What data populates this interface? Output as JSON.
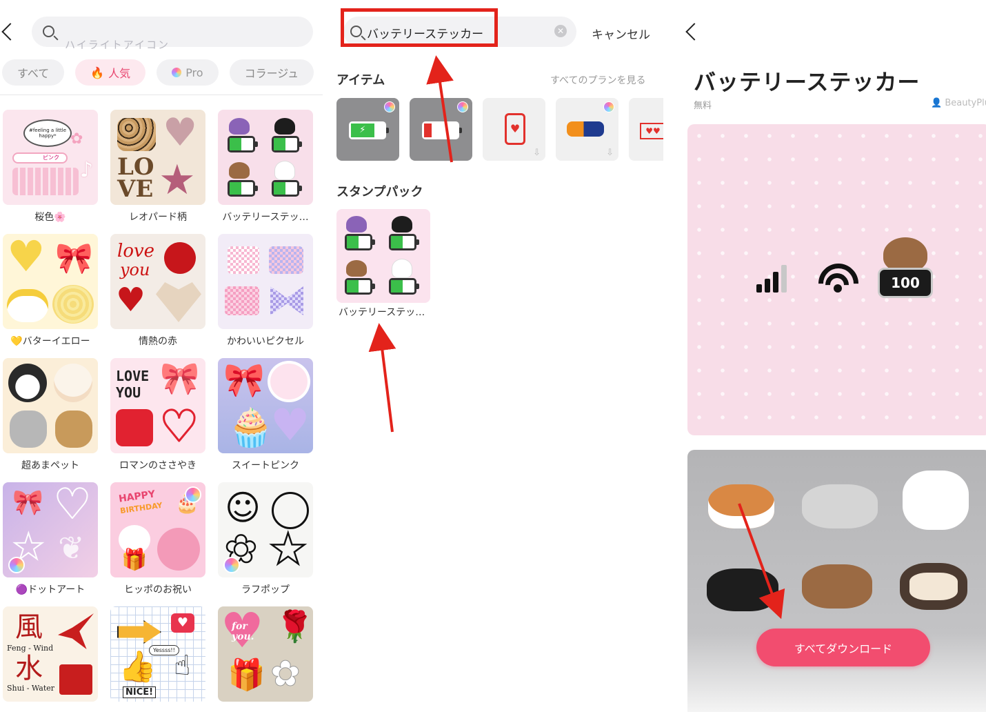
{
  "panel_list": {
    "search_placeholder": "ハイライトアイコン",
    "chips": [
      {
        "label": "すべて"
      },
      {
        "label": "人気",
        "icon": "flame-icon"
      },
      {
        "label": "Pro",
        "icon": "pro-gem-icon"
      },
      {
        "label": "コラージュ"
      }
    ],
    "tiles": [
      {
        "caption": "桜色🌸"
      },
      {
        "caption": "レオパード柄"
      },
      {
        "caption": "バッテリーステッ…"
      },
      {
        "caption": "💛バターイエロー"
      },
      {
        "caption": "情熱の赤"
      },
      {
        "caption": "かわいいピクセル"
      },
      {
        "caption": "超あまペット"
      },
      {
        "caption": "ロマンのささやき"
      },
      {
        "caption": "スイートピンク"
      },
      {
        "caption": "🟣ドットアート"
      },
      {
        "caption": "ヒッポのお祝い"
      },
      {
        "caption": "ラフポップ"
      },
      {
        "caption": ""
      },
      {
        "caption": ""
      },
      {
        "caption": ""
      }
    ],
    "tile_art": {
      "sakura_bubble": "#feeling a little happy*",
      "sakura_key": "ピンク",
      "love_word_1": "LO",
      "love_word_2": "VE",
      "red_love": "love",
      "red_you": "you",
      "pixel_love": "LOVE",
      "pixel_you": "YOU",
      "happy": "HAPPY",
      "birthday": "BIRTHDAY",
      "for_you": "for you.",
      "feng_char": "風",
      "feng_label": "Feng - Wind",
      "shui_char": "水",
      "shui_label": "Shui - Water",
      "yes_bubble": "Yessss!!",
      "nice": "NICE!"
    }
  },
  "panel_search": {
    "query": "バッテリーステッカー",
    "cancel_label": "キャンセル",
    "items_title": "アイテム",
    "see_all_plans": "すべてのプランを見る",
    "packs_title": "スタンプパック",
    "pack_caption": "バッテリーステッ…"
  },
  "panel_detail": {
    "title": "バッテリーステッカー",
    "price": "無料",
    "author": "BeautyPlus",
    "battery_level": "100",
    "download_all": "すべてダウンロード"
  },
  "colors": {
    "accent": "#f24d6f",
    "chip_active_bg": "#fde9ef",
    "annotation_red": "#e3231b",
    "preview_bg": "#f8dde8"
  }
}
